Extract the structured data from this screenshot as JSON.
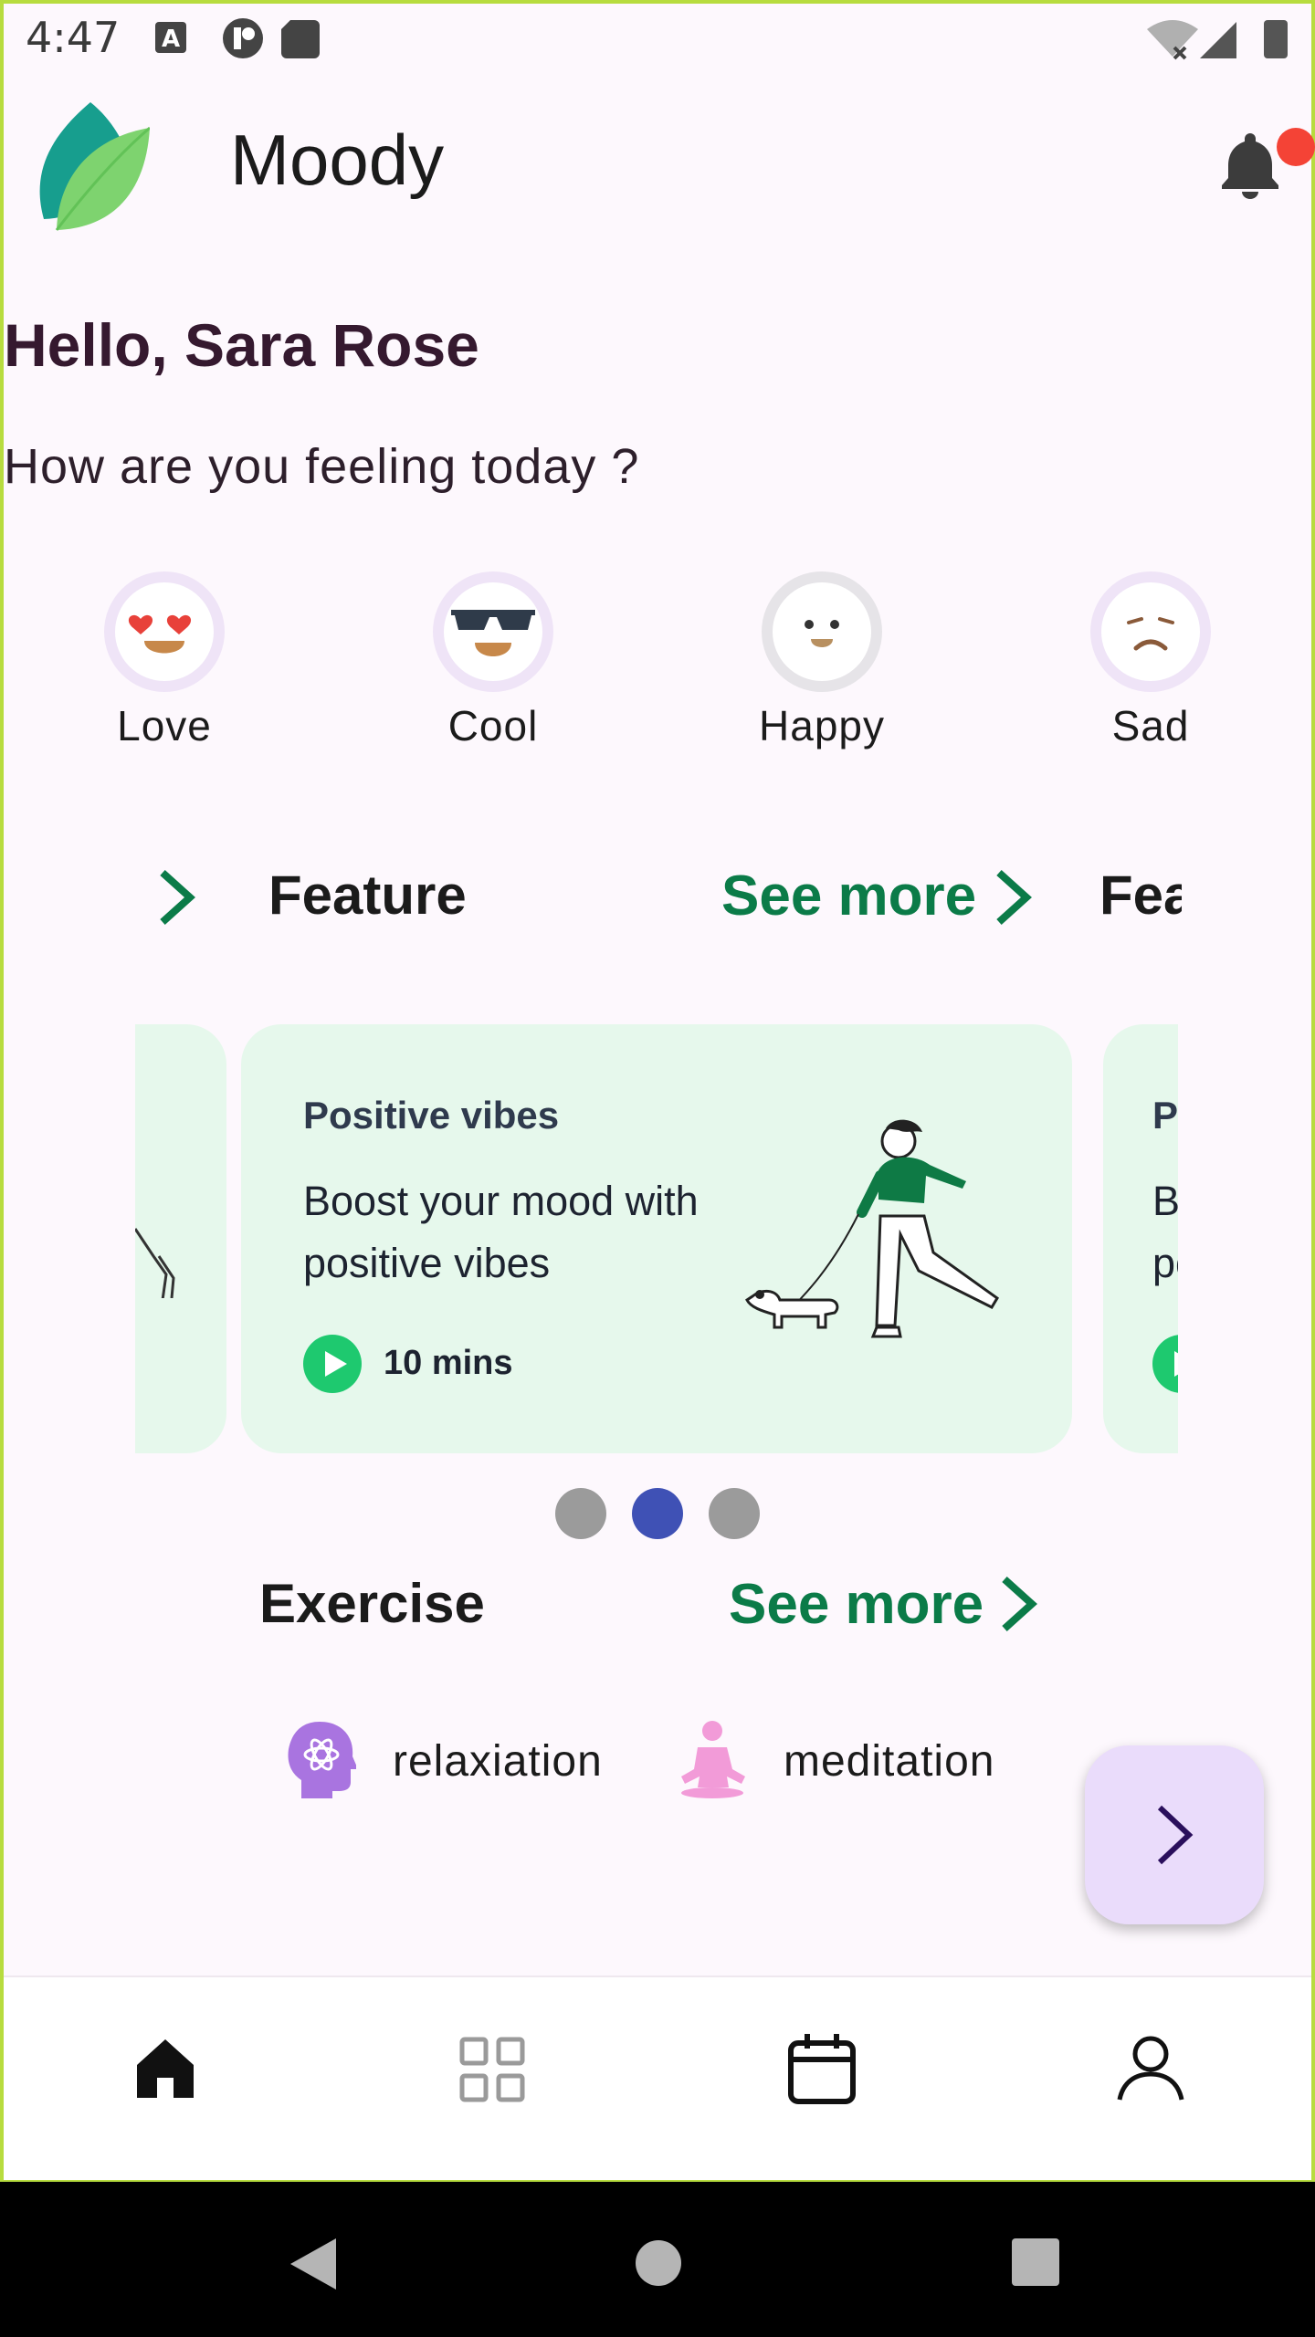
{
  "status_bar": {
    "time": "4:47"
  },
  "app_bar": {
    "title": "Moody"
  },
  "greeting": "Hello, Sara Rose",
  "question": "How are you feeling today ?",
  "moods": [
    {
      "label": "Love"
    },
    {
      "label": "Cool"
    },
    {
      "label": "Happy"
    },
    {
      "label": "Sad"
    }
  ],
  "feature_section": {
    "title": "Feature",
    "see_more": "See more",
    "next_title_partial": "Fea"
  },
  "carousel": {
    "active_index": 1,
    "cards": [
      {
        "title": "Positive vibes",
        "body": "Boost your mood with positive vibes",
        "duration": "10 mins"
      },
      {
        "title": "Po",
        "body": "Bo po",
        "duration": ""
      }
    ],
    "dots": 3
  },
  "exercise_section": {
    "title": "Exercise",
    "see_more": "See more",
    "items": [
      {
        "label": "relaxiation",
        "icon": "head-atom-icon"
      },
      {
        "label": "meditation",
        "icon": "meditation-icon"
      }
    ]
  },
  "bottom_nav": [
    "home-icon",
    "grid-icon",
    "calendar-icon",
    "profile-icon"
  ],
  "colors": {
    "accent_green": "#0b7b48",
    "dot_active": "#3f51b5",
    "fab_bg": "#eadcfb",
    "card_bg": "#e6f8ec"
  }
}
